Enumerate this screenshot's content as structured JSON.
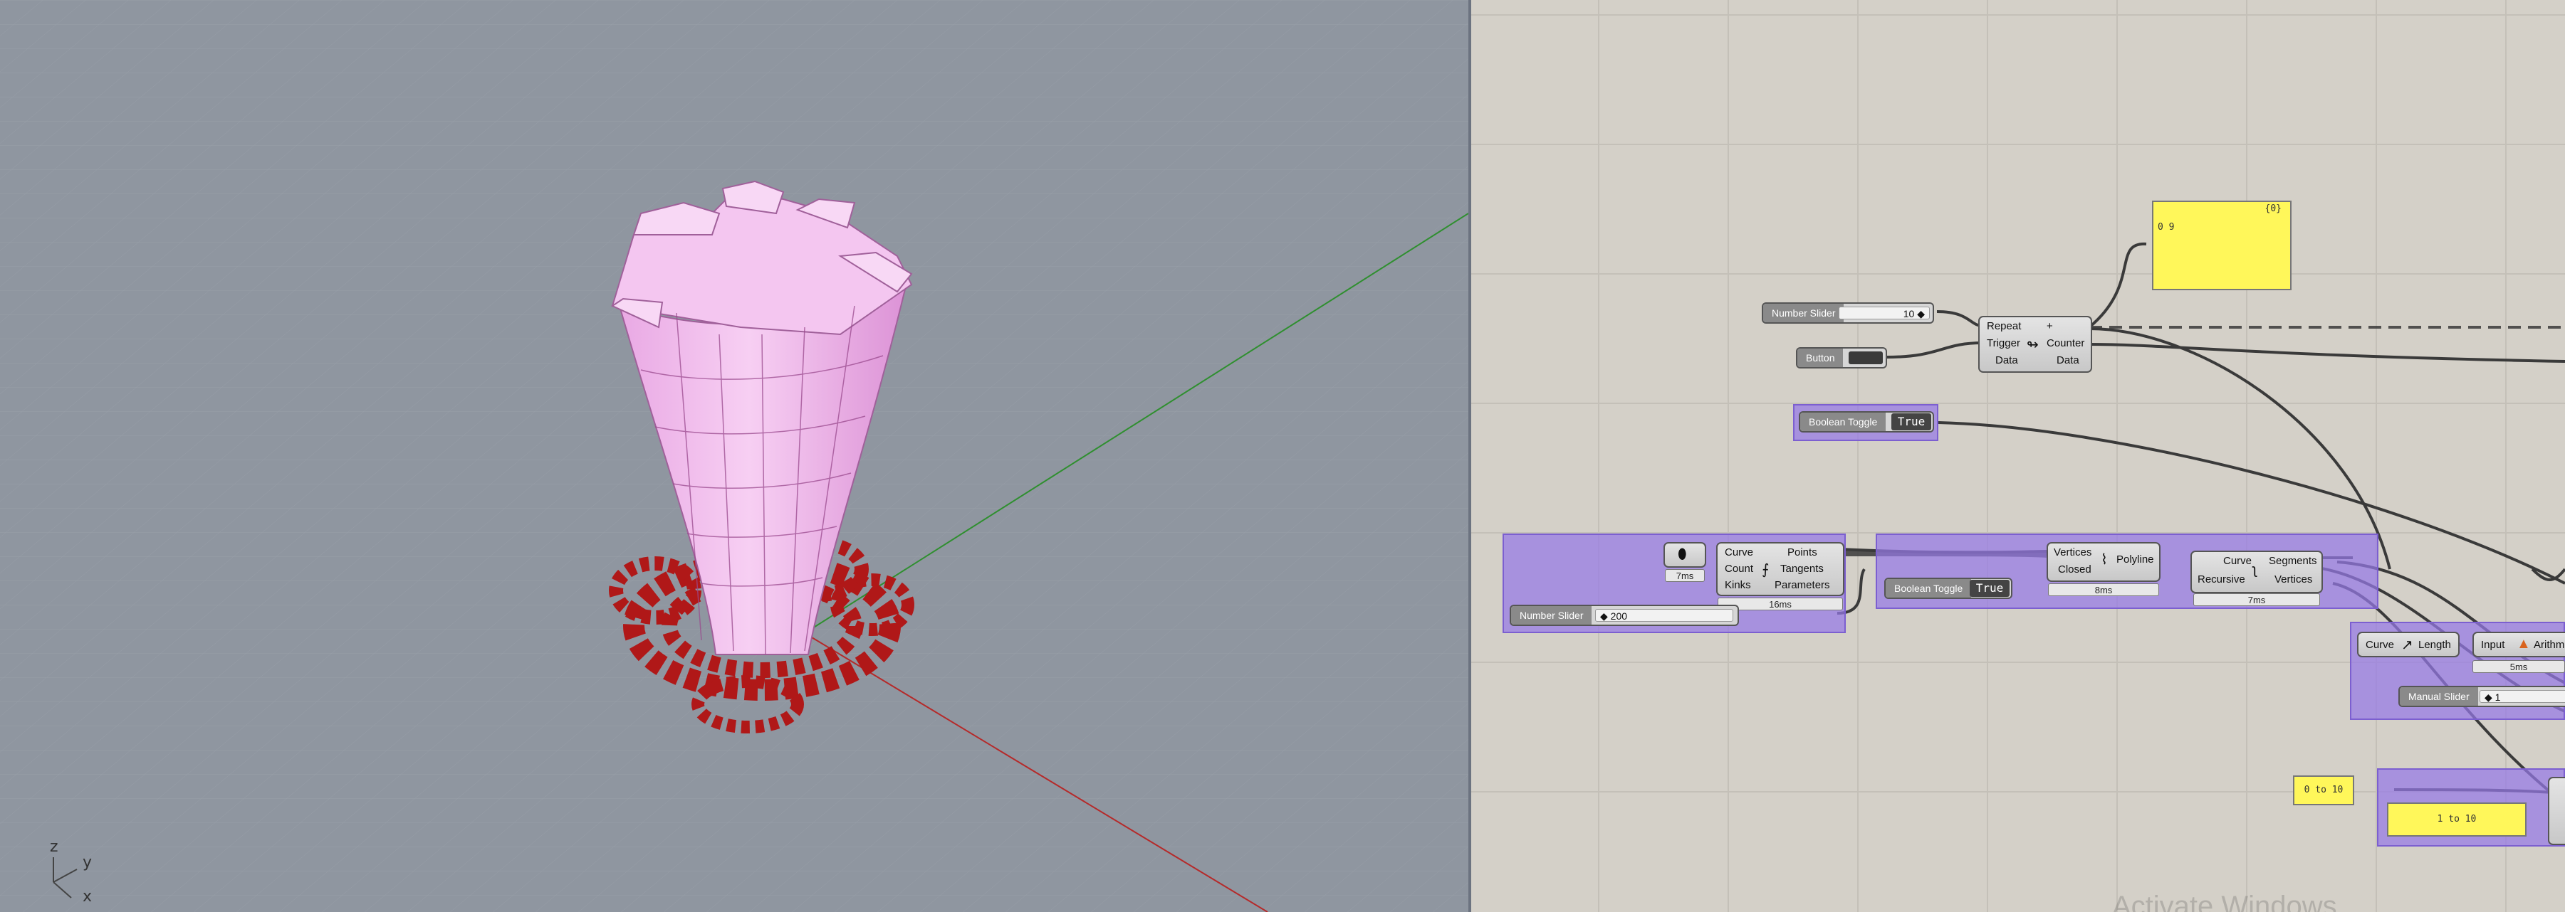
{
  "viewport": {
    "axis_labels": {
      "z": "z",
      "y": "y",
      "x": "x"
    }
  },
  "canvas": {
    "number_slider_1": {
      "name": "Number Slider",
      "value": "10 ◆"
    },
    "button": {
      "name": "Button"
    },
    "counter": {
      "inputs": [
        "Repeat",
        "Trigger",
        "Data"
      ],
      "outputs": [
        "+",
        "Counter",
        "Data"
      ]
    },
    "panel_top": {
      "header": "{0}",
      "content": "0  9"
    },
    "boolean_toggle_1": {
      "name": "Boolean Toggle",
      "value": "True"
    },
    "divide_curve": {
      "inputs": [
        "Curve",
        "Count",
        "Kinks"
      ],
      "outputs": [
        "Points",
        "Tangents",
        "Parameters"
      ],
      "timer": "16ms",
      "source_timer": "7ms"
    },
    "number_slider_2": {
      "name": "Number Slider",
      "value": "◆ 200"
    },
    "polyline": {
      "inputs": [
        "Vertices",
        "Closed"
      ],
      "name": "Polyline",
      "timer": "8ms"
    },
    "boolean_toggle_2": {
      "name": "Boolean Toggle",
      "value": "True"
    },
    "explode": {
      "inputs": [
        "Curve",
        "Recursive"
      ],
      "outputs": [
        "Segments",
        "Vertices"
      ],
      "timer": "7ms"
    },
    "length": {
      "input": "Curve",
      "output": "Length"
    },
    "arith": {
      "input": "Input",
      "name": "Arithme",
      "timer": "5ms"
    },
    "manual_slider": {
      "name": "Manual Slider",
      "value": "◆ 1"
    },
    "panel_range_a": {
      "content": "0 to 10"
    },
    "panel_range_b": {
      "content": "1 to 10"
    },
    "watermark": "Activate Windows"
  },
  "colors": {
    "viewport_bg": "#8f96a0",
    "canvas_bg": "#d4d0c8",
    "group_fill": "#9678e6",
    "panel_fill": "#fff75a",
    "tower_pink": "#f2b8ee",
    "base_red": "#b01818",
    "axis_green": "#2f8f2f",
    "axis_red": "#b52a2a"
  }
}
